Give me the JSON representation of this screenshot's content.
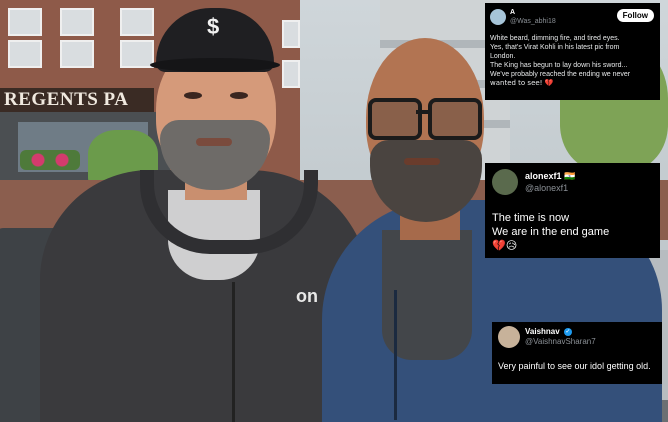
{
  "background": {
    "sign_text": "REGENTS PA",
    "cap_logo": "$",
    "hoodie_logo": "on"
  },
  "tweets": [
    {
      "name": "A",
      "handle": "@Was_abhi18",
      "follow_label": "Follow",
      "lines": [
        "White beard, dimming fire, and tired eyes.",
        "Yes, that's Virat Kohli in his latest pic from",
        "London.",
        "The King has begun to lay down his sword...",
        "We've probably reached the ending we never",
        "wanted to see! 💔"
      ]
    },
    {
      "name": "alonexf1",
      "name_flag": "🇮🇳",
      "handle": "@alonexf1",
      "lines": [
        "The time is now",
        "We are in the end game",
        "💔😥"
      ]
    },
    {
      "name": "Vaishnav",
      "verified": "✓",
      "handle": "@VaishnavSharan7",
      "lines": [
        "Very painful to see our idol getting old."
      ]
    }
  ],
  "colors": {
    "card_bg": "#000000",
    "follow_bg": "#ffffff",
    "verified": "#1d9bf0"
  }
}
